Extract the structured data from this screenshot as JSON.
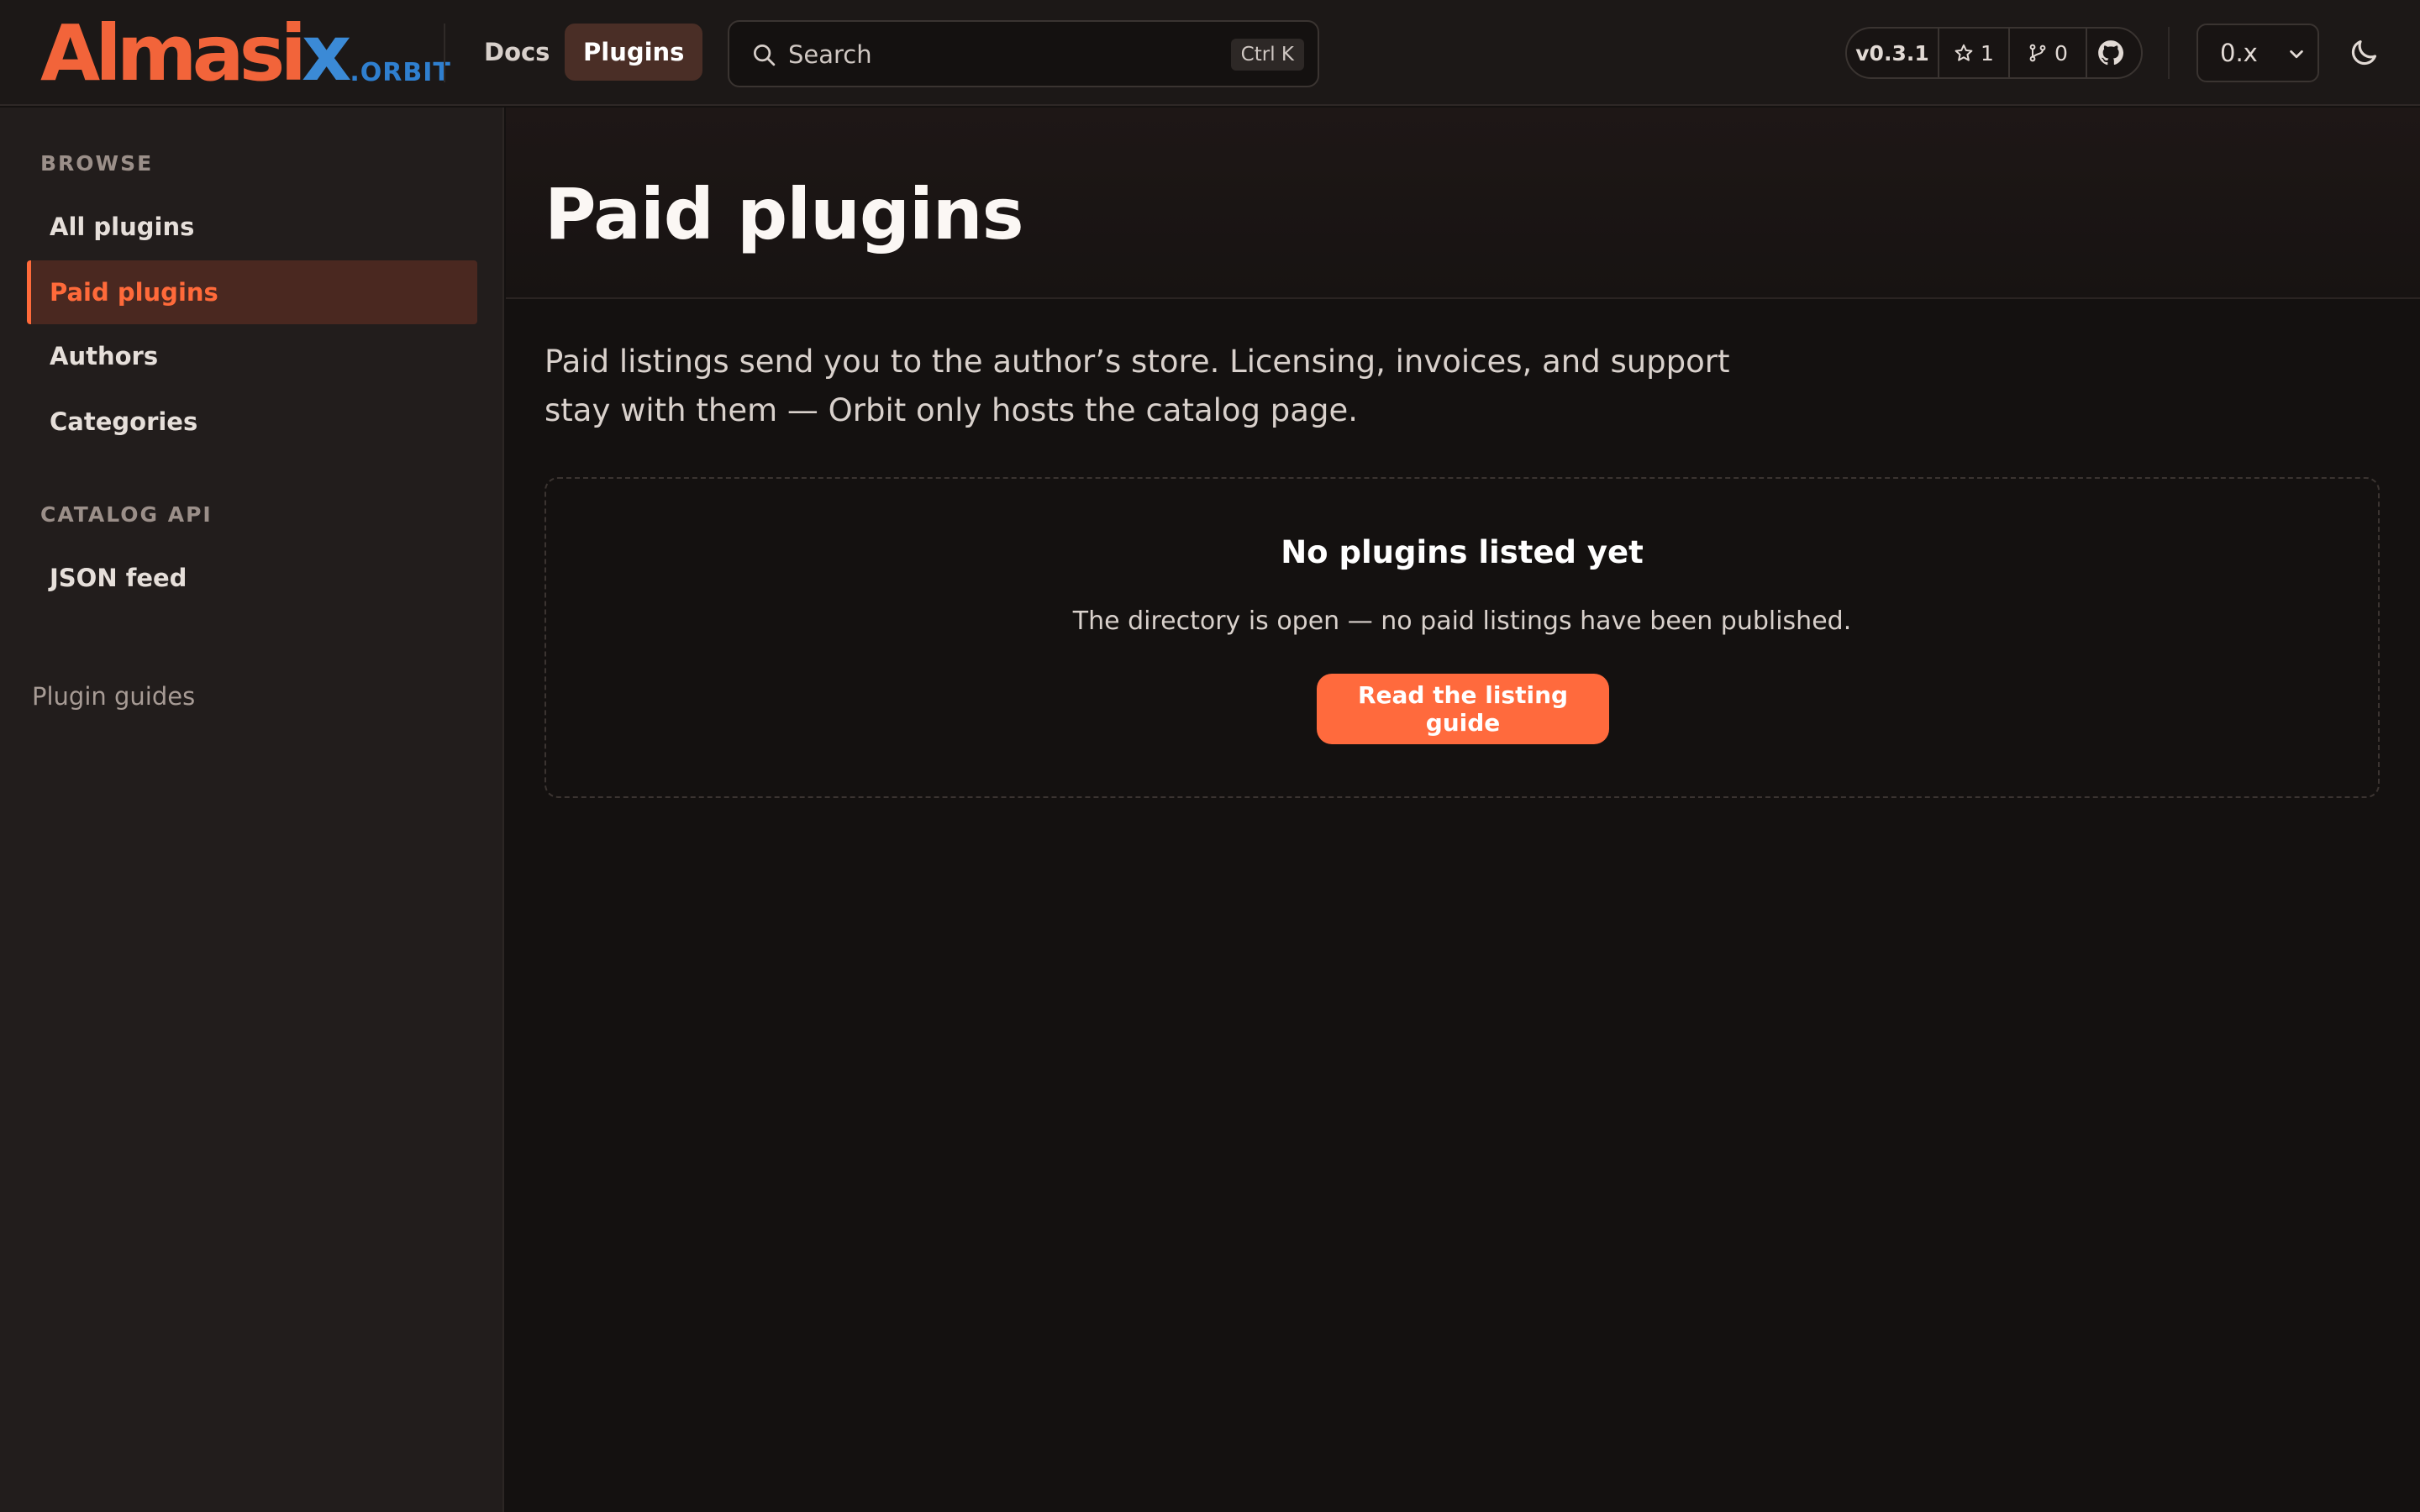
{
  "brand": {
    "logo_main_a": "Almasi",
    "logo_main_b": "x",
    "logo_sub": ".ORBIT",
    "accent": "#ff6a3d",
    "logo_blue": "#3b8ad6"
  },
  "header": {
    "nav": [
      {
        "label": "Docs",
        "active": false
      },
      {
        "label": "Plugins",
        "active": true
      }
    ],
    "search": {
      "placeholder": "Search",
      "shortcut": "Ctrl K",
      "icon": "search-icon"
    },
    "repo": {
      "version": "v0.3.1",
      "stars": "1",
      "forks": "0",
      "icons": [
        "star-icon",
        "fork-icon",
        "github-icon"
      ]
    },
    "version_select": {
      "selected": "0.x"
    },
    "theme_icon": "moon-icon"
  },
  "sidebar": {
    "sections": [
      {
        "heading": "BROWSE",
        "items": [
          {
            "label": "All plugins",
            "active": false
          },
          {
            "label": "Paid plugins",
            "active": true
          },
          {
            "label": "Authors",
            "active": false
          },
          {
            "label": "Categories",
            "active": false
          }
        ]
      },
      {
        "heading": "CATALOG API",
        "items": [
          {
            "label": "JSON feed",
            "active": false
          }
        ]
      }
    ],
    "footer_link": "Plugin guides"
  },
  "main": {
    "title": "Paid plugins",
    "intro": "Paid listings send you to the author’s store. Licensing, invoices, and support stay with them — Orbit only hosts the catalog page.",
    "empty_state": {
      "title": "No plugins listed yet",
      "text": "The directory is open — no paid listings have been published.",
      "button": "Read the listing guide"
    }
  }
}
